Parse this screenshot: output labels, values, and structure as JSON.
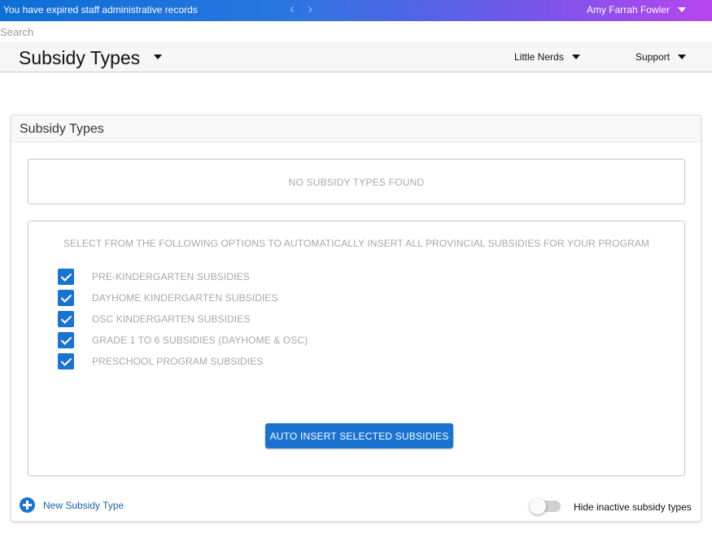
{
  "topbar": {
    "alert_text": "You have expired staff administrative records",
    "nav_arrows": "‹ ›",
    "user_name": "Amy Farrah Fowler"
  },
  "search": {
    "placeholder": "Search",
    "value": ""
  },
  "header": {
    "page_title": "Subsidy Types",
    "program_menu_label": "Little Nerds",
    "support_menu_label": "Support"
  },
  "card": {
    "title": "Subsidy Types",
    "empty_message": "NO SUBSIDY TYPES FOUND",
    "options_heading": "SELECT FROM THE FOLLOWING OPTIONS TO AUTOMATICALLY INSERT ALL PROVINCIAL SUBSIDIES FOR YOUR PROGRAM",
    "options": [
      {
        "label": "PRE-KINDERGARTEN SUBSIDIES",
        "checked": true
      },
      {
        "label": "DAYHOME KINDERGARTEN SUBSIDIES",
        "checked": true
      },
      {
        "label": "OSC KINDERGARTEN SUBSIDIES",
        "checked": true
      },
      {
        "label": "GRADE 1 TO 6 SUBSIDIES (DAYHOME & OSC)",
        "checked": true
      },
      {
        "label": "PRESCHOOL PROGRAM SUBSIDIES",
        "checked": true
      }
    ],
    "auto_insert_label": "AUTO INSERT SELECTED SUBSIDIES",
    "new_subsidy_label": "New Subsidy Type",
    "hide_inactive_label": "Hide inactive subsidy types",
    "hide_inactive_on": false
  },
  "colors": {
    "accent": "#1a73d1",
    "banner_start": "#0d6fd6",
    "banner_end": "#b845f0"
  }
}
